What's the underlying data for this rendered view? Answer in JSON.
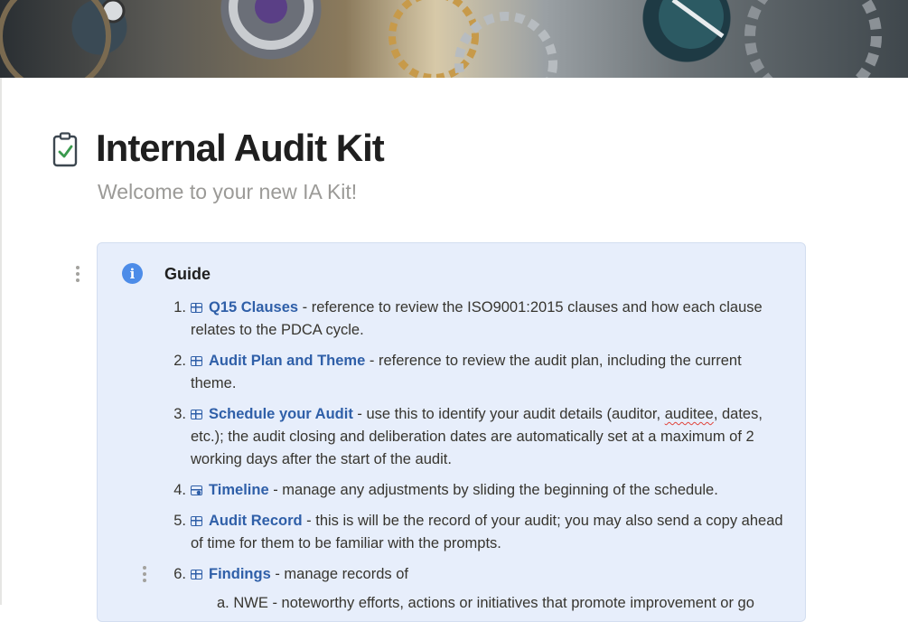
{
  "page": {
    "title": "Internal Audit Kit",
    "subtitle": "Welcome to your new IA Kit!",
    "icon": "clipboard-check-icon"
  },
  "callout": {
    "icon": "info-icon",
    "icon_glyph": "i",
    "title": "Guide",
    "background": "#e7eefb",
    "items": [
      {
        "number": "1.",
        "icon": "table-icon",
        "link": "Q15 Clauses",
        "text_before": " - reference to review the ISO9001:2015 clauses and how each clause relates to the PDCA cycle.",
        "flagged_word": "",
        "text_after": ""
      },
      {
        "number": "2.",
        "icon": "table-icon",
        "link": "Audit Plan and Theme",
        "text_before": " - reference to review the audit plan, including the current theme.",
        "flagged_word": "",
        "text_after": ""
      },
      {
        "number": "3.",
        "icon": "table-icon",
        "link": "Schedule your Audit",
        "text_before": " - use this to identify your audit details (auditor, ",
        "flagged_word": "auditee",
        "text_after": ", dates, etc.); the audit closing and deliberation dates are automatically set at a maximum of 2 working days after the start of the audit."
      },
      {
        "number": "4.",
        "icon": "timeline-icon",
        "link": "Timeline",
        "text_before": " - manage any adjustments by sliding the beginning of the schedule.",
        "flagged_word": "",
        "text_after": ""
      },
      {
        "number": "5.",
        "icon": "table-icon",
        "link": "Audit Record",
        "text_before": " - this is will be the record of your audit; you may also send a copy ahead of time for them to be familiar with the prompts.",
        "flagged_word": "",
        "text_after": ""
      },
      {
        "number": "6.",
        "icon": "table-icon",
        "link": "Findings",
        "text_before": " - manage records of",
        "flagged_word": "",
        "text_after": ""
      }
    ],
    "sub_item": {
      "marker": "a.",
      "text": "NWE - noteworthy efforts, actions or initiatives that promote improvement or go"
    }
  },
  "colors": {
    "link": "#2f5fa8",
    "info_icon": "#4d8ce8",
    "subtitle": "#9b9a97"
  }
}
